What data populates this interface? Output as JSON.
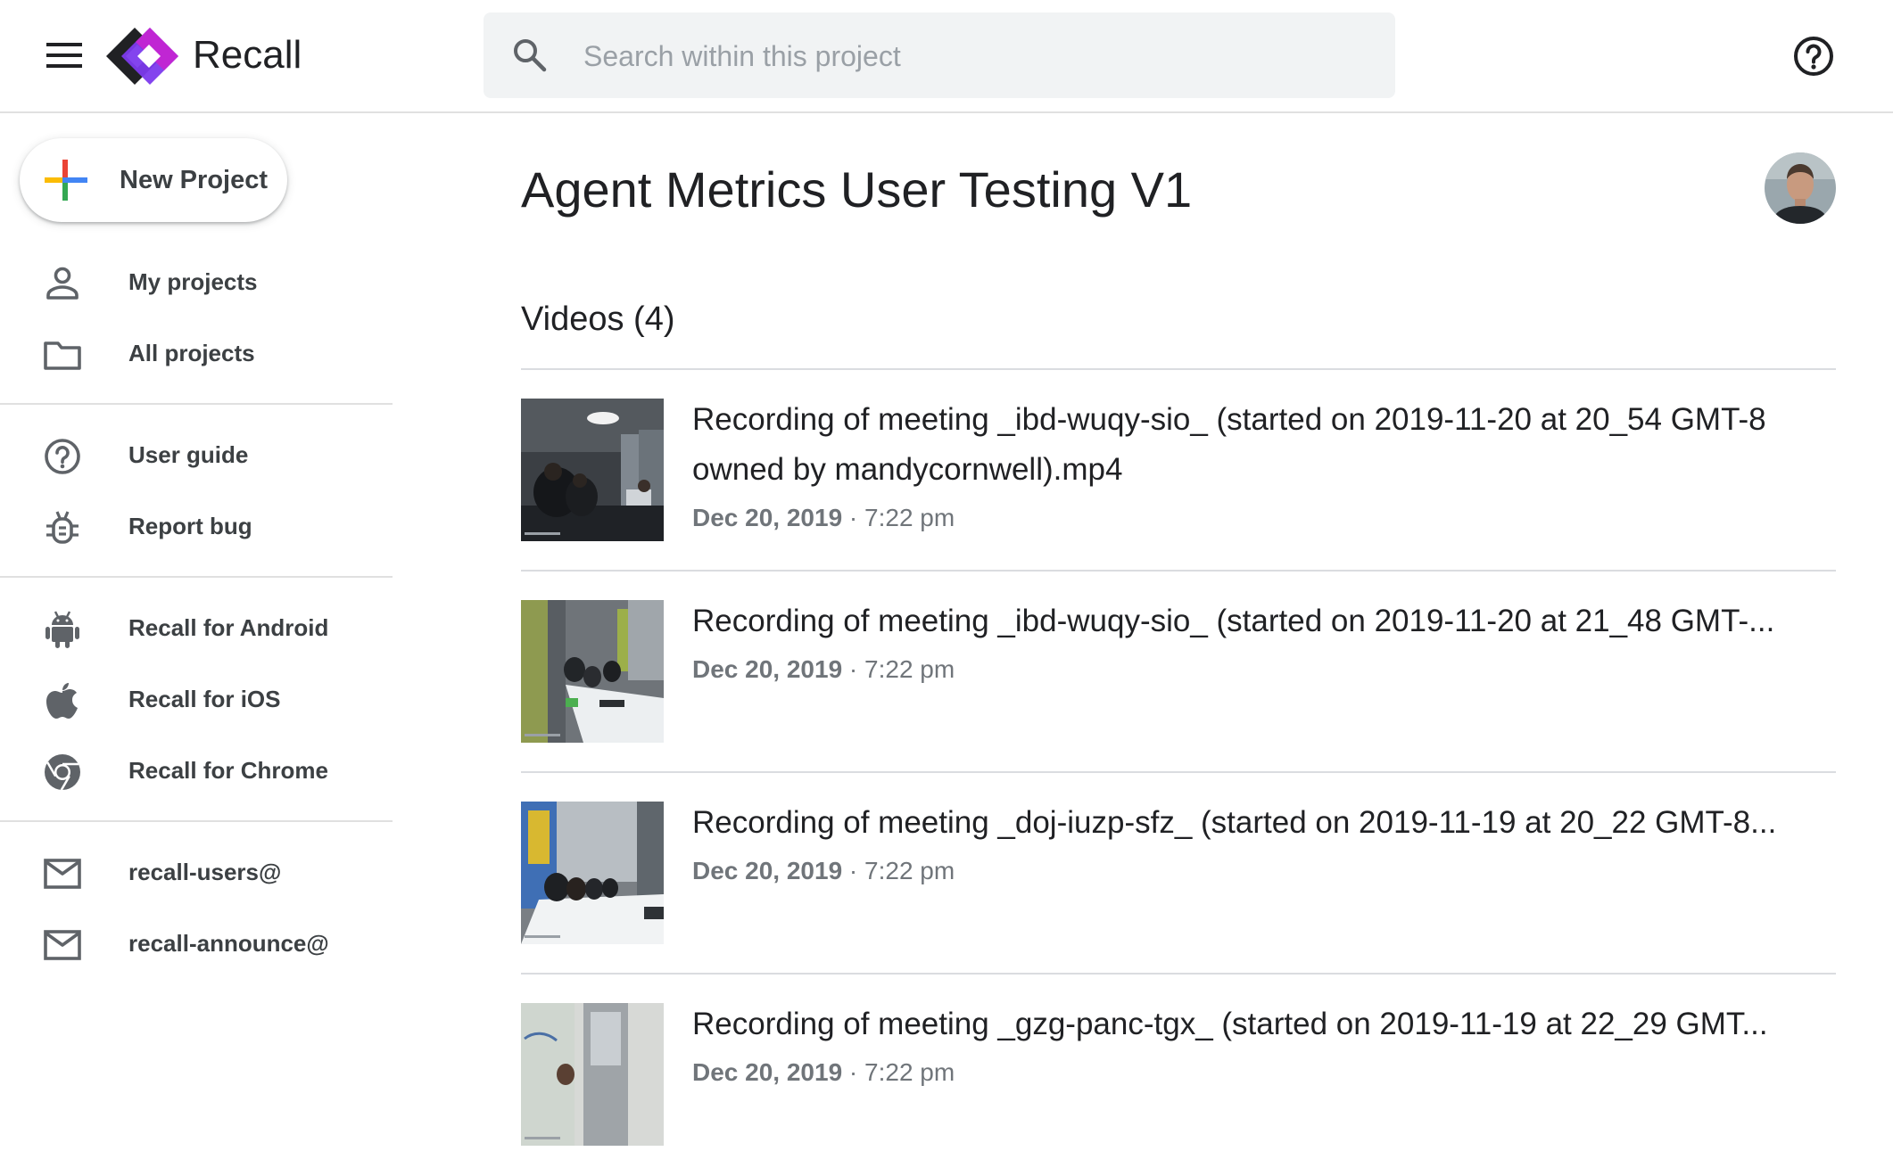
{
  "app": {
    "name": "Recall",
    "brand_colors": [
      "#6b21d6",
      "#c026d3",
      "#202124"
    ]
  },
  "header": {
    "menu_icon": "hamburger-menu-icon",
    "search": {
      "placeholder": "Search within this project",
      "value": ""
    },
    "help_icon": "help-circle-icon"
  },
  "sidebar": {
    "new_project_label": "New Project",
    "groups": [
      [
        {
          "label": "My projects",
          "icon": "person-icon"
        },
        {
          "label": "All projects",
          "icon": "folder-icon"
        }
      ],
      [
        {
          "label": "User guide",
          "icon": "help-circle-icon"
        },
        {
          "label": "Report bug",
          "icon": "bug-icon"
        }
      ],
      [
        {
          "label": "Recall for Android",
          "icon": "android-icon"
        },
        {
          "label": "Recall for iOS",
          "icon": "apple-icon"
        },
        {
          "label": "Recall for Chrome",
          "icon": "chrome-icon"
        }
      ],
      [
        {
          "label": "recall-users@",
          "icon": "mail-icon"
        },
        {
          "label": "recall-announce@",
          "icon": "mail-icon"
        }
      ]
    ]
  },
  "main": {
    "title": "Agent Metrics User Testing V1",
    "videos_heading": "Videos (4)",
    "videos": [
      {
        "title": "Recording of meeting _ibd-wuqy-sio_ (started on 2019-11-20 at 20_54 GMT-8 owned by mandycornwell).mp4",
        "date": "Dec 20, 2019",
        "time": "7:22 pm"
      },
      {
        "title": "Recording of meeting _ibd-wuqy-sio_ (started on 2019-11-20 at 21_48 GMT-...",
        "date": "Dec 20, 2019",
        "time": "7:22 pm"
      },
      {
        "title": "Recording of meeting _doj-iuzp-sfz_ (started on 2019-11-19 at 20_22 GMT-8...",
        "date": "Dec 20, 2019",
        "time": "7:22 pm"
      },
      {
        "title": "Recording of meeting _gzg-panc-tgx_ (started on 2019-11-19 at 22_29 GMT...",
        "date": "Dec 20, 2019",
        "time": "7:22 pm"
      }
    ]
  }
}
